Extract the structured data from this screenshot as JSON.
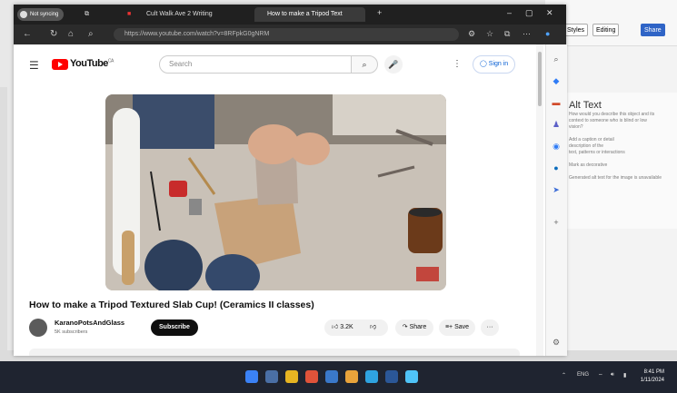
{
  "word": {
    "editing_label": "Editing",
    "share_label": "Share",
    "styles_label": "Styles",
    "alt_panel": {
      "title": "Alt Text",
      "lines": [
        "How would you describe this object and its",
        "context to someone who is blind or low",
        "vision?",
        "",
        "Add a caption or detail",
        "description of the",
        "text, patterns or interactions",
        "",
        "Mark as decorative",
        "",
        "Generated alt text for the image is unavailable"
      ]
    }
  },
  "browser": {
    "tabs": [
      {
        "label": "Not syncing",
        "active": false
      },
      {
        "label": "Cult Walk Ave 2 Writing",
        "active": false
      },
      {
        "label": "How to make a Tripod Text",
        "active": true
      }
    ],
    "url": "https://www.youtube.com/watch?v=8RFpkG0gNRM"
  },
  "youtube": {
    "logo_text": "YouTube",
    "logo_region": "CA",
    "search_placeholder": "Search",
    "sign_in_label": "Sign in",
    "video_title": "How to make a Tripod Textured Slab Cup! (Ceramics II classes)",
    "channel_name": "KaranoPotsAndGlass",
    "subscriber_count": "5K subscribers",
    "subscribe_label": "Subscribe",
    "likes": "3.2K",
    "share_label": "Share",
    "save_label": "Save",
    "more_label": "···"
  },
  "taskbar": {
    "time": "8:41 PM",
    "date": "1/11/2024",
    "lang": "ENG"
  },
  "colors": {
    "youtube_red": "#ff0000",
    "link_blue": "#065fd4",
    "taskbar": "#1f2430",
    "browser_chrome": "#202020"
  }
}
